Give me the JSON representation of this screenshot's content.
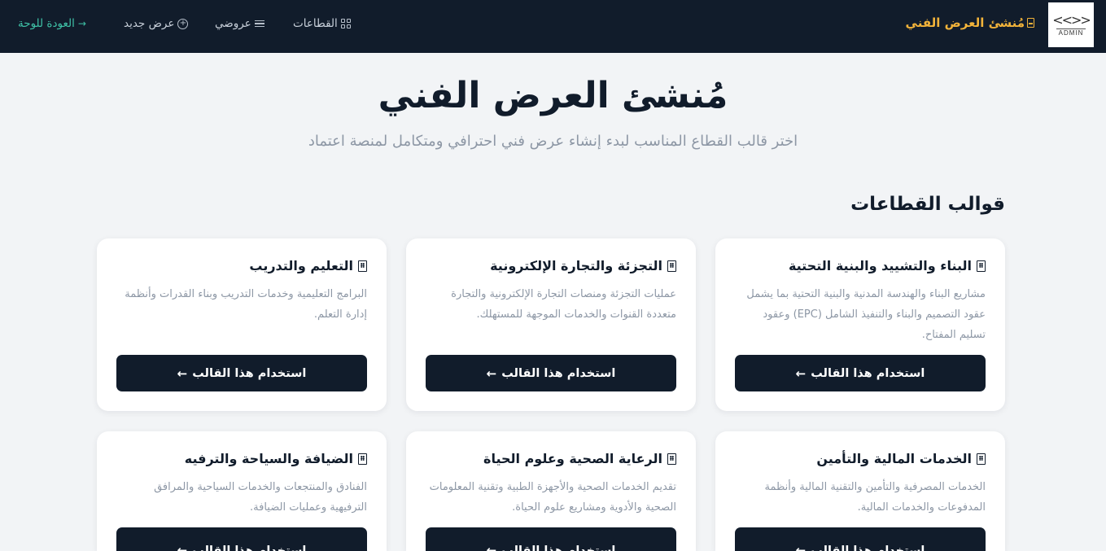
{
  "navbar": {
    "logo_text": "ADMIN",
    "brand": "مُنشئ العرض الفني",
    "links": {
      "sectors": "القطاعات",
      "my_offers": "عروضي",
      "new_offer": "عرض جديد",
      "back": "العودة للوحة"
    }
  },
  "hero": {
    "title": "مُنشئ العرض الفني",
    "subtitle": "اختر قالب القطاع المناسب لبدء إنشاء عرض فني احترافي ومتكامل لمنصة اعتماد"
  },
  "section": {
    "title": "قوالب القطاعات"
  },
  "button_label": "استخدام هذا القالب",
  "cards": [
    {
      "title": "البناء والتشييد والبنية التحتية",
      "description": "مشاريع البناء والهندسة المدنية والبنية التحتية بما يشمل عقود التصميم والبناء والتنفيذ الشامل (EPC) وعقود تسليم المفتاح."
    },
    {
      "title": "التجزئة والتجارة الإلكترونية",
      "description": "عمليات التجزئة ومنصات التجارة الإلكترونية والتجارة متعددة القنوات والخدمات الموجهة للمستهلك."
    },
    {
      "title": "التعليم والتدريب",
      "description": "البرامج التعليمية وخدمات التدريب وبناء القدرات وأنظمة إدارة التعلم."
    },
    {
      "title": "الخدمات المالية والتأمين",
      "description": "الخدمات المصرفية والتأمين والتقنية المالية وأنظمة المدفوعات والخدمات المالية."
    },
    {
      "title": "الرعاية الصحية وعلوم الحياة",
      "description": "تقديم الخدمات الصحية والأجهزة الطبية وتقنية المعلومات الصحية والأدوية ومشاريع علوم الحياة."
    },
    {
      "title": "الضيافة والسياحة والترفيه",
      "description": "الفنادق والمنتجعات والخدمات السياحية والمرافق الترفيهية وعمليات الضيافة."
    }
  ],
  "colors": {
    "navbar_bg": "#111c2b",
    "brand_accent": "#f2b33a",
    "back_link": "#3fc2a7",
    "page_bg": "#f2f4f6",
    "button_bg": "#111c2b"
  }
}
